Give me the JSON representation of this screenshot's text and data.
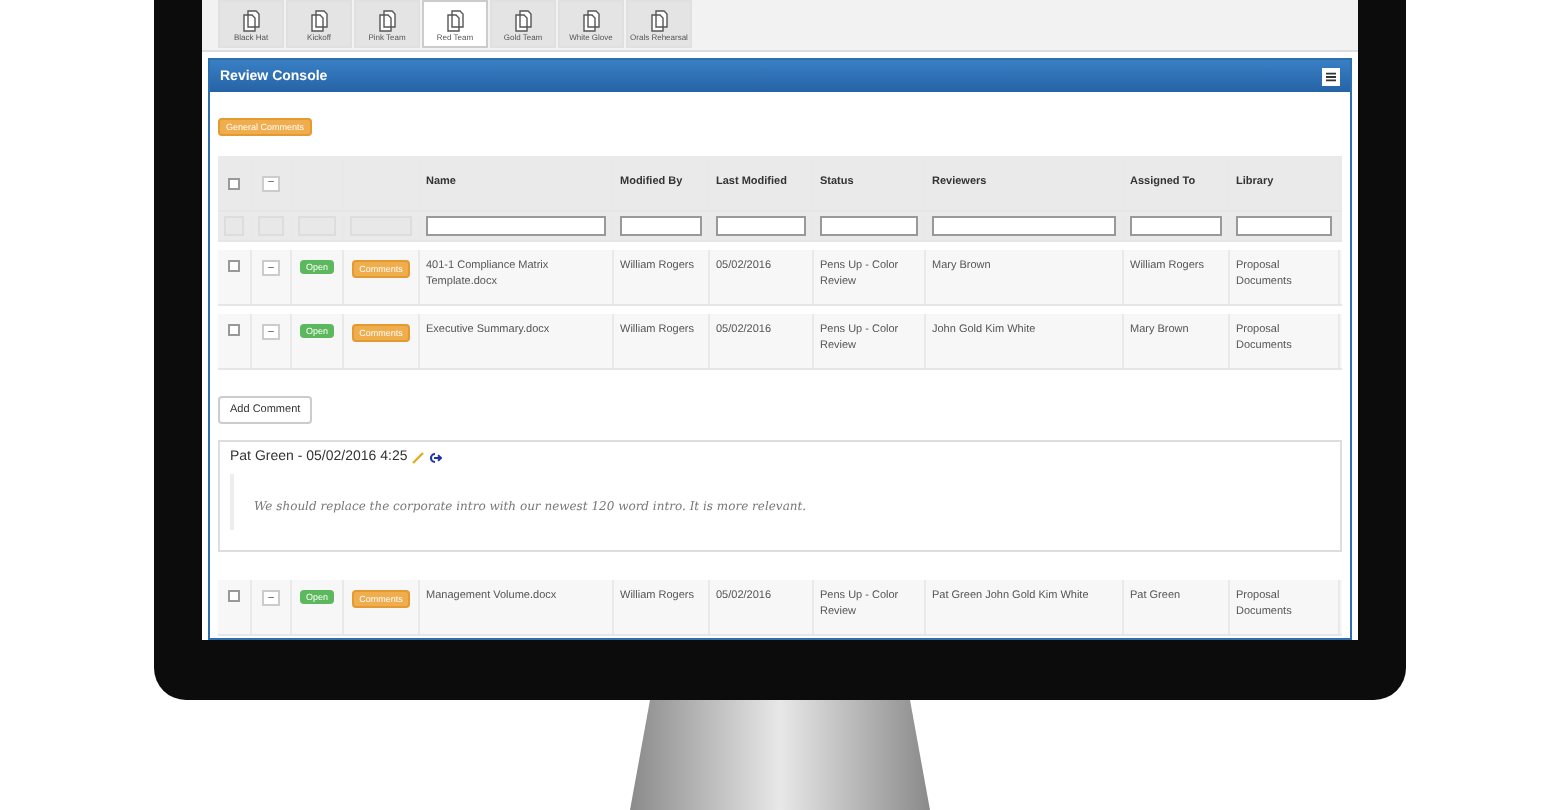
{
  "tabs": [
    {
      "label": "Black Hat",
      "selected": false
    },
    {
      "label": "Kickoff",
      "selected": false
    },
    {
      "label": "Pink Team",
      "selected": false
    },
    {
      "label": "Red Team",
      "selected": true
    },
    {
      "label": "Gold Team",
      "selected": false
    },
    {
      "label": "White Glove",
      "selected": false
    },
    {
      "label": "Orals Rehearsal",
      "selected": false
    }
  ],
  "panel": {
    "title": "Review Console",
    "general_comments_button": "General Comments"
  },
  "table": {
    "header_checkbox": {
      "checked": false
    },
    "header_toggle": "–",
    "columns": [
      "Name",
      "Modified By",
      "Last Modified",
      "Status",
      "Reviewers",
      "Assigned To",
      "Library"
    ],
    "rows": [
      {
        "checked": false,
        "toggle": "–",
        "open": "Open",
        "comments": "Comments",
        "name": "401-1 Compliance Matrix Template.docx",
        "modified_by": "William Rogers",
        "last_modified": "05/02/2016",
        "status": "Pens Up - Color Review",
        "reviewers": "Mary Brown",
        "assigned_to": "William Rogers",
        "library": "Proposal Documents"
      },
      {
        "checked": false,
        "toggle": "–",
        "open": "Open",
        "comments": "Comments",
        "name": "Executive Summary.docx",
        "modified_by": "William Rogers",
        "last_modified": "05/02/2016",
        "status": "Pens Up - Color Review",
        "reviewers": "John Gold  Kim White",
        "assigned_to": "Mary Brown",
        "library": "Proposal Documents"
      }
    ],
    "comment_section": {
      "add_button": "Add Comment",
      "comments": [
        {
          "author": "Pat Green - 05/02/2016 4:25",
          "text": "We should replace the corporate intro with our newest 120 word intro. It is more relevant."
        }
      ]
    },
    "more_rows": [
      {
        "checked": false,
        "toggle": "–",
        "open": "Open",
        "comments": "Comments",
        "name": "Management Volume.docx",
        "modified_by": "William Rogers",
        "last_modified": "05/02/2016",
        "status": "Pens Up - Color Review",
        "reviewers": "Pat Green  John Gold  Kim White",
        "assigned_to": "Pat Green",
        "library": "Proposal Documents"
      }
    ]
  }
}
